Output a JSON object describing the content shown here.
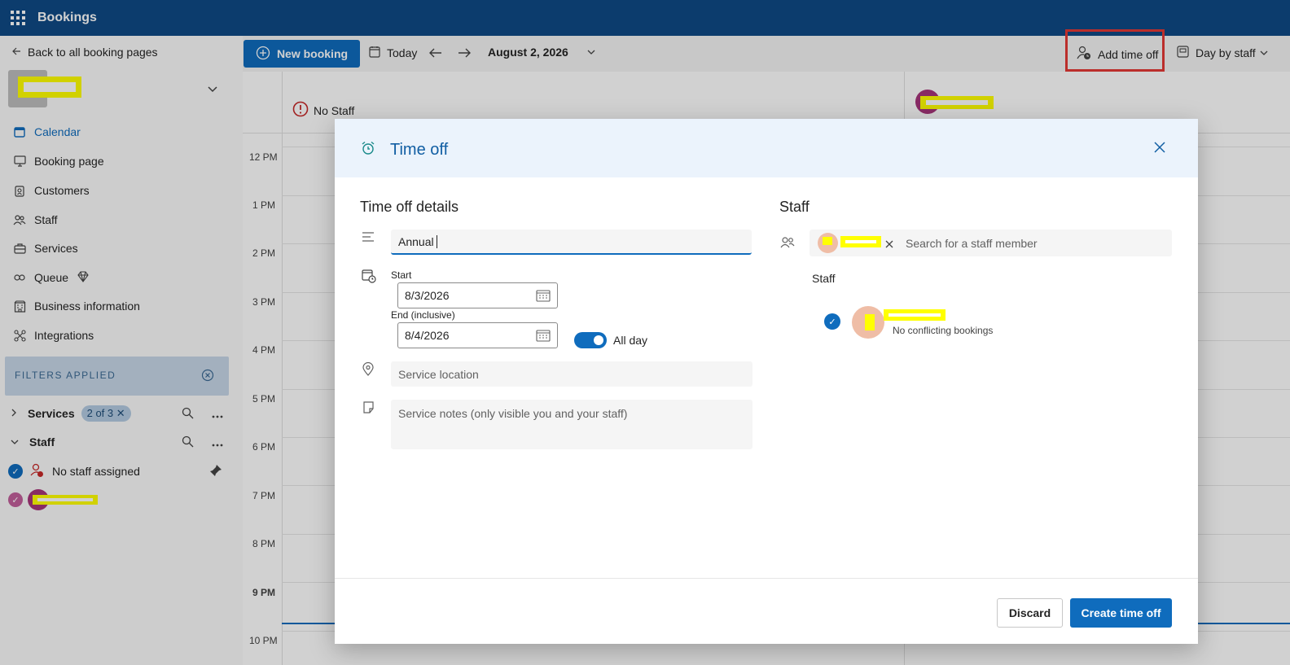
{
  "app": {
    "title": "Bookings"
  },
  "sidebar": {
    "back_label": "Back to all booking pages",
    "items": [
      {
        "label": "Calendar",
        "icon": "calendar-icon",
        "active": true
      },
      {
        "label": "Booking page",
        "icon": "monitor-icon"
      },
      {
        "label": "Customers",
        "icon": "contact-card-icon"
      },
      {
        "label": "Staff",
        "icon": "people-icon"
      },
      {
        "label": "Services",
        "icon": "briefcase-icon"
      },
      {
        "label": "Queue",
        "icon": "queue-icon"
      },
      {
        "label": "Business information",
        "icon": "building-icon"
      },
      {
        "label": "Integrations",
        "icon": "integrations-icon"
      }
    ],
    "filters_label": "FILTERS APPLIED",
    "services_filter": {
      "label": "Services",
      "pill": "2 of 3"
    },
    "staff_filter": {
      "label": "Staff"
    },
    "no_staff_label": "No staff assigned"
  },
  "toolbar": {
    "new_booking": "New booking",
    "today": "Today",
    "date": "August 2, 2026",
    "add_time_off": "Add time off",
    "view": "Day by staff"
  },
  "calendar": {
    "no_staff": "No Staff",
    "hours": [
      "12 PM",
      "1 PM",
      "2 PM",
      "3 PM",
      "4 PM",
      "5 PM",
      "6 PM",
      "7 PM",
      "8 PM",
      "9 PM",
      "10 PM"
    ]
  },
  "dialog": {
    "title": "Time off",
    "details_title": "Time off details",
    "title_value": "Annual",
    "start_label": "Start",
    "start_value": "8/3/2026",
    "end_label": "End (inclusive)",
    "end_value": "8/4/2026",
    "all_day": "All day",
    "location_placeholder": "Service location",
    "notes_placeholder": "Service notes (only visible you and your staff)",
    "staff_title": "Staff",
    "staff_search_placeholder": "Search for a staff member",
    "staff_list_label": "Staff",
    "no_conflicts": "No conflicting bookings",
    "discard": "Discard",
    "create": "Create time off"
  },
  "colors": {
    "brand": "#0f4a85",
    "accent": "#0f6cbd",
    "highlight": "#e53935",
    "redaction": "#ffff00"
  }
}
